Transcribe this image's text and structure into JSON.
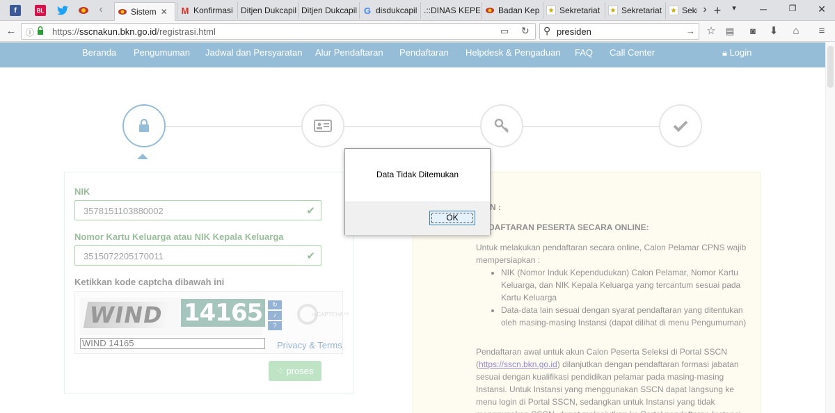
{
  "browser": {
    "pinned_tabs": [
      {
        "icon": "facebook-icon",
        "label": "f",
        "color": "#3b5998"
      },
      {
        "icon": "bukalapak-icon",
        "label": "BL",
        "color": "#d71149"
      },
      {
        "icon": "twitter-icon",
        "label": "",
        "color": "#1da1f2"
      },
      {
        "icon": "garuda-icon",
        "label": "",
        "color": "#b5651d"
      }
    ],
    "tabs": [
      {
        "label": "Sistem",
        "icon": "garuda-icon",
        "active": true
      },
      {
        "label": "Konfirmasi",
        "icon": "gmail-icon"
      },
      {
        "label": "Ditjen Dukcapil",
        "icon": ""
      },
      {
        "label": "Ditjen Dukcapil",
        "icon": ""
      },
      {
        "label": "disdukcapil",
        "icon": "google-icon"
      },
      {
        "label": ".::DINAS KEPEN",
        "icon": ""
      },
      {
        "label": "Badan Kep",
        "icon": "garuda-icon"
      },
      {
        "label": "Sekretariat",
        "icon": "star-icon"
      },
      {
        "label": "Sekretariat",
        "icon": "star-icon"
      },
      {
        "label": "Sekre",
        "icon": "star-icon"
      }
    ],
    "url_host": "sscnakun.bkn.go.id",
    "url_path": "/registrasi.html",
    "url_scheme": "https://",
    "search_value": "presiden"
  },
  "site": {
    "menu": [
      "Beranda",
      "Pengumuman",
      "Jadwal dan Persyaratan",
      "Alur Pendaftaran",
      "Pendaftaran",
      "Helpdesk & Pengaduan",
      "FAQ",
      "Call Center"
    ],
    "login_label": "Login",
    "steps": [
      "lock-icon",
      "id-card-icon",
      "key-icon",
      "checkmark-icon"
    ],
    "form": {
      "nik_label": "NIK",
      "nik_value": "3578151103880002",
      "kk_label": "Nomor Kartu Keluarga atau NIK Kepala Keluarga",
      "kk_value": "3515072205170011",
      "captcha_label": "Ketikkan kode captcha dibawah ini",
      "captcha_word1": "WIND",
      "captcha_word2": "14165",
      "captcha_answer": "WIND 14165",
      "recaptcha_text": "reCAPTCHA™",
      "privacy_label": "Privacy & Terms",
      "submit_label": "proses"
    },
    "info": {
      "heading": "N :",
      "subheading": "DAFTARAN PESERTA SECARA ONLINE:",
      "intro": "Untuk melakukan pendaftaran secara online, Calon Pelamar CPNS wajib mempersiapkan :",
      "bullets": [
        "NIK (Nomor Induk Kependudukan) Calon Pelamar, Nomor Kartu Keluarga, dan NIK Kepala Keluarga yang tercantum sesuai pada Kartu Keluarga",
        "Data-data lain sesuai dengan syarat pendaftaran yang ditentukan oleh masing-masing Instansi (dapat dilihat di menu Pengumuman)"
      ],
      "para2_pre": "Pendaftaran awal untuk akun Calon Peserta Seleksi di Portal SSCN (",
      "para2_link": "https://sscn.bkn.go.id",
      "para2_post": ") dilanjutkan dengan pendaftaran formasi jabatan sesuai dengan kualifikasi pendidikan pelamar pada masing-masing Instansi. Untuk Instansi yang menggunakan SSCN dapat langsung ke menu login di Portal SSCN, sedangkan untuk Instansi yang tidak menggunakan SSCN, dapat melanjutkan ke Portal pendaftaran Instansi."
    }
  },
  "dialog": {
    "message": "Data Tidak Ditemukan",
    "ok_label": "OK"
  }
}
